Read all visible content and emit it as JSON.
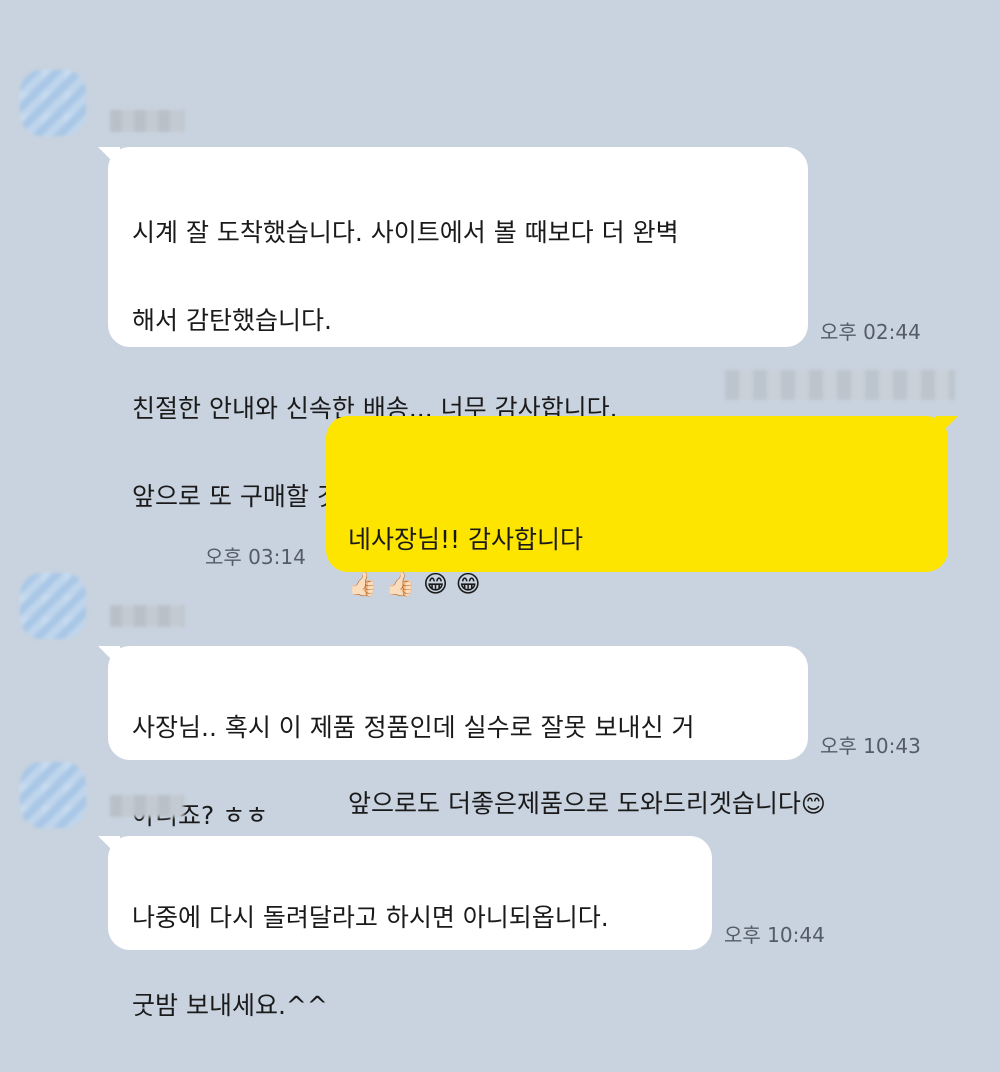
{
  "colors": {
    "background": "#c9d3df",
    "incoming_bubble": "#ffffff",
    "outgoing_bubble": "#fee500",
    "time_text": "#545c66"
  },
  "messages": [
    {
      "direction": "in",
      "lines": [
        "시계 잘 도착했습니다. 사이트에서 볼 때보다 더 완벽",
        "해서 감탄했습니다.",
        "친절한 안내와 신속한 배송... 너무 감사합니다.",
        "앞으로 또 구매할 것 같네요.^^"
      ],
      "time": "오후 02:44"
    },
    {
      "direction": "out",
      "line1_text": "네사장님!! 감사합니다 ",
      "line1_emojis": "👍🏻 👍🏻 😁 😁",
      "line2_text": "앞으로도 더좋은제품으로 도와드리겟습니다",
      "line2_emoji": "😊",
      "time": "오후 03:14"
    },
    {
      "direction": "in",
      "lines": [
        "사장님.. 혹시 이 제품 정품인데 실수로 잘못 보내신 거",
        "아니죠? ㅎㅎ"
      ],
      "time": "오후 10:43"
    },
    {
      "direction": "in",
      "lines": [
        "나중에 다시 돌려달라고 하시면 아니되옵니다.",
        "굿밤 보내세요.^^"
      ],
      "time": "오후 10:44"
    }
  ]
}
